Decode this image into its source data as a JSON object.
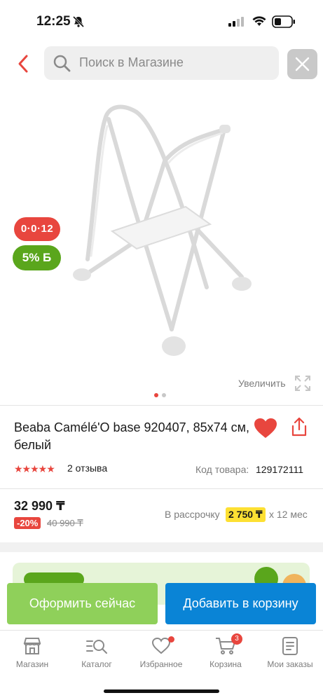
{
  "status_bar": {
    "time": "12:25"
  },
  "header": {
    "search_placeholder": "Поиск в Магазине"
  },
  "gallery": {
    "age_badge": "0·0·12",
    "bonus_badge": "5% Б",
    "zoom_label": "Увеличить",
    "slides_total": 2,
    "active_slide": 1,
    "accent": "#e8463e"
  },
  "product": {
    "title": "Beaba Camélé'O base 920407, 85x74 см, белый",
    "rating_stars": "★★★★★",
    "reviews": "2 отзыва",
    "code_label": "Код товара:",
    "code_value": "129172111"
  },
  "price": {
    "current": "32 990 ₸",
    "discount": "-20%",
    "old": "40 990 ₸",
    "installment_label": "В рассрочку",
    "installment_value": "2 750 ₸",
    "installment_term": "х 12 мес"
  },
  "actions": {
    "buy_now": "Оформить сейчас",
    "add_to_cart": "Добавить в корзину"
  },
  "tabs": [
    {
      "label": "Магазин",
      "icon": "store-icon"
    },
    {
      "label": "Каталог",
      "icon": "catalog-search-icon"
    },
    {
      "label": "Избранное",
      "icon": "heart-icon"
    },
    {
      "label": "Корзина",
      "icon": "cart-icon",
      "badge": "3"
    },
    {
      "label": "Мои заказы",
      "icon": "orders-icon"
    }
  ],
  "colors": {
    "red": "#e8463e",
    "green": "#5aa61c",
    "blue": "#0a84d6",
    "light_green": "#8fd05a",
    "yellow": "#fde033"
  }
}
